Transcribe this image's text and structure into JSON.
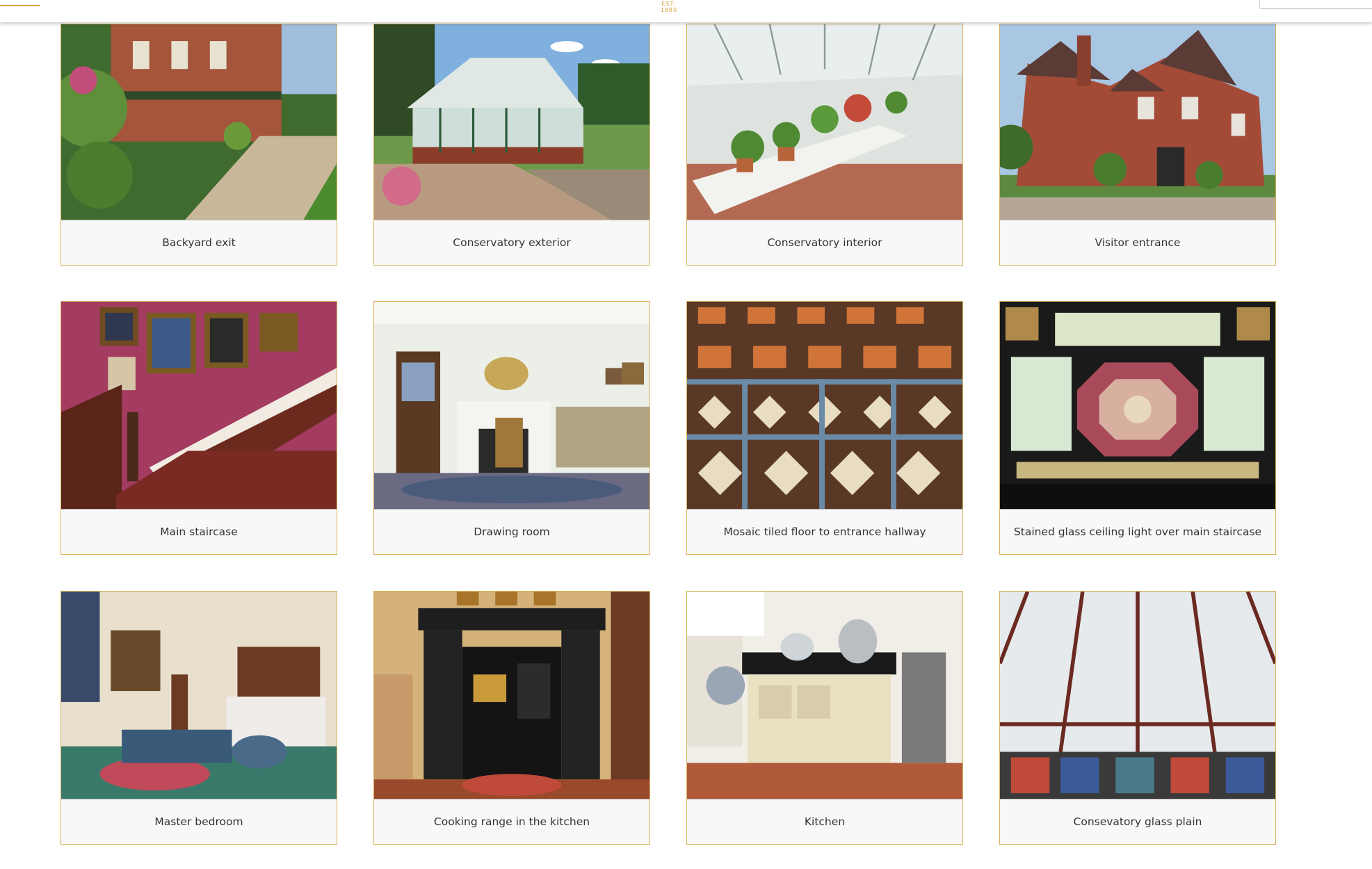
{
  "header": {
    "est_label": "EST-1880"
  },
  "gallery": {
    "items": [
      {
        "caption": "Backyard exit",
        "icon": "backyard-exit-photo"
      },
      {
        "caption": "Conservatory exterior",
        "icon": "conservatory-exterior-photo"
      },
      {
        "caption": "Conservatory interior",
        "icon": "conservatory-interior-photo"
      },
      {
        "caption": "Visitor entrance",
        "icon": "visitor-entrance-photo"
      },
      {
        "caption": "Main staircase",
        "icon": "main-staircase-photo"
      },
      {
        "caption": "Drawing room",
        "icon": "drawing-room-photo"
      },
      {
        "caption": "Mosaic tiled floor to entrance hallway",
        "icon": "mosaic-floor-photo"
      },
      {
        "caption": "Stained glass ceiling light over main staircase",
        "icon": "stained-glass-photo"
      },
      {
        "caption": "Master bedroom",
        "icon": "master-bedroom-photo"
      },
      {
        "caption": "Cooking range in the kitchen",
        "icon": "cooking-range-photo"
      },
      {
        "caption": "Kitchen",
        "icon": "kitchen-photo"
      },
      {
        "caption": "Consevatory glass plain",
        "icon": "conservatory-glass-photo"
      }
    ]
  },
  "colors": {
    "accent": "#d9a23a",
    "card_border": "#d6b25c",
    "caption_bg": "#f8f8f8",
    "caption_text": "#333333"
  }
}
